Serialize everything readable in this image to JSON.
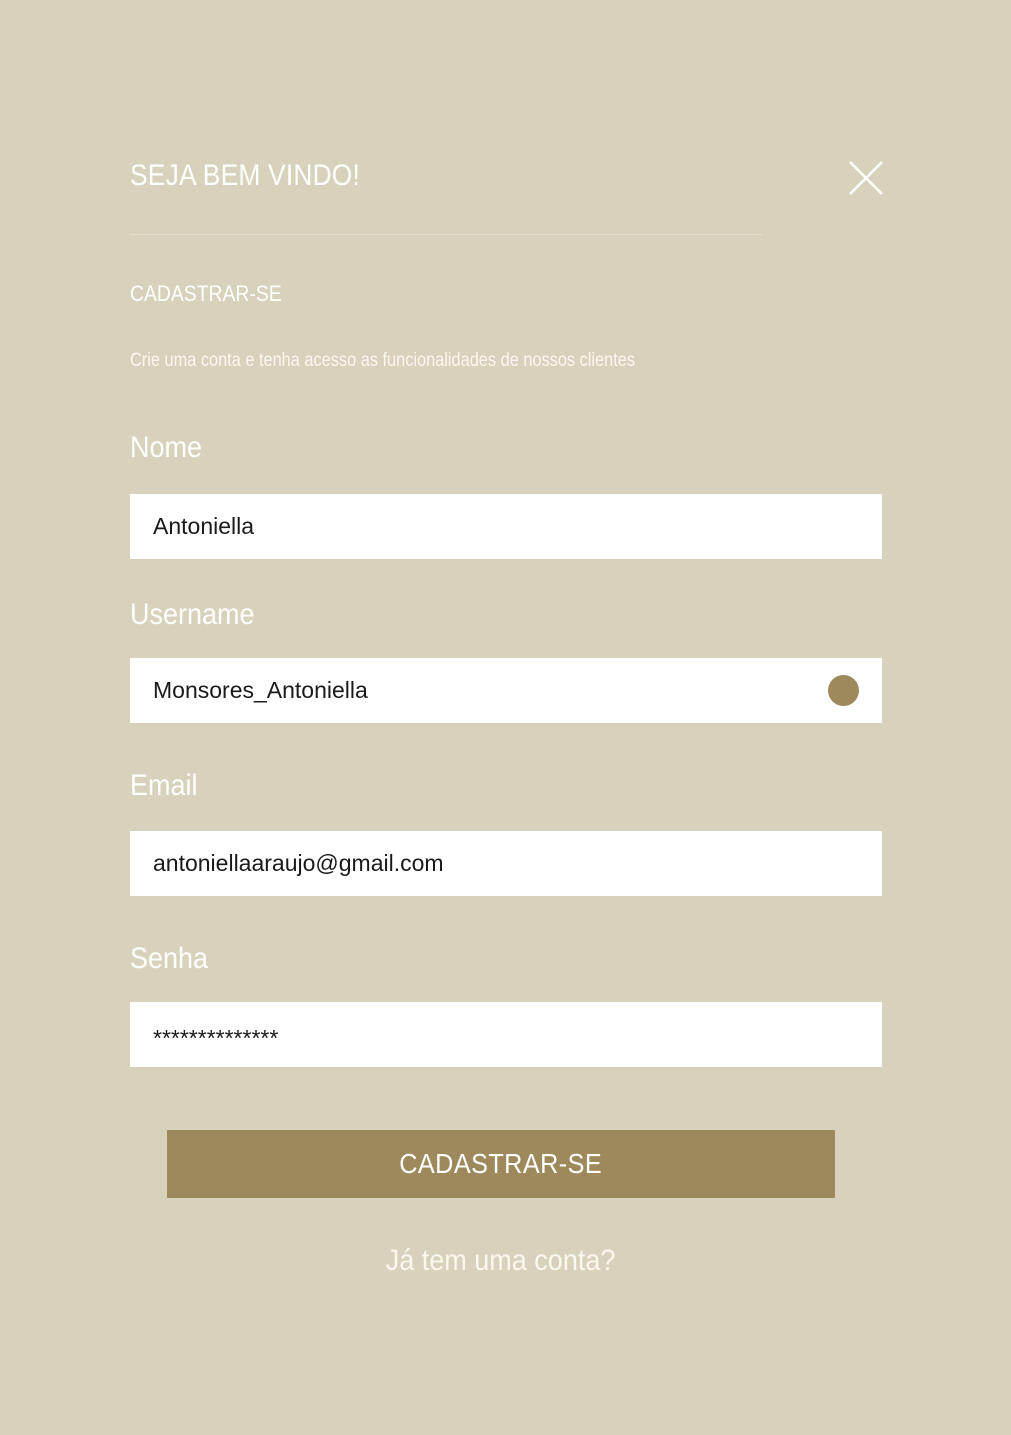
{
  "header": {
    "title": "SEJA BEM VINDO!",
    "close_icon": "close-icon"
  },
  "section": {
    "title": "CADASTRAR-SE",
    "subtitle": "Crie uma conta e tenha acesso as funcionalidades de nossos clientes"
  },
  "form": {
    "name": {
      "label": "Nome",
      "value": "Antoniella"
    },
    "username": {
      "label": "Username",
      "value": "Monsores_Antoniella",
      "status_icon": "status-dot-icon"
    },
    "email": {
      "label": "Email",
      "value": "antoniellaaraujo@gmail.com"
    },
    "password": {
      "label": "Senha",
      "value": "**************"
    },
    "submit_label": "CADASTRAR-SE",
    "login_link": "Já tem uma conta?"
  },
  "colors": {
    "background": "#d8d1bb",
    "accent": "#9e895d",
    "text": "#ffffff"
  }
}
